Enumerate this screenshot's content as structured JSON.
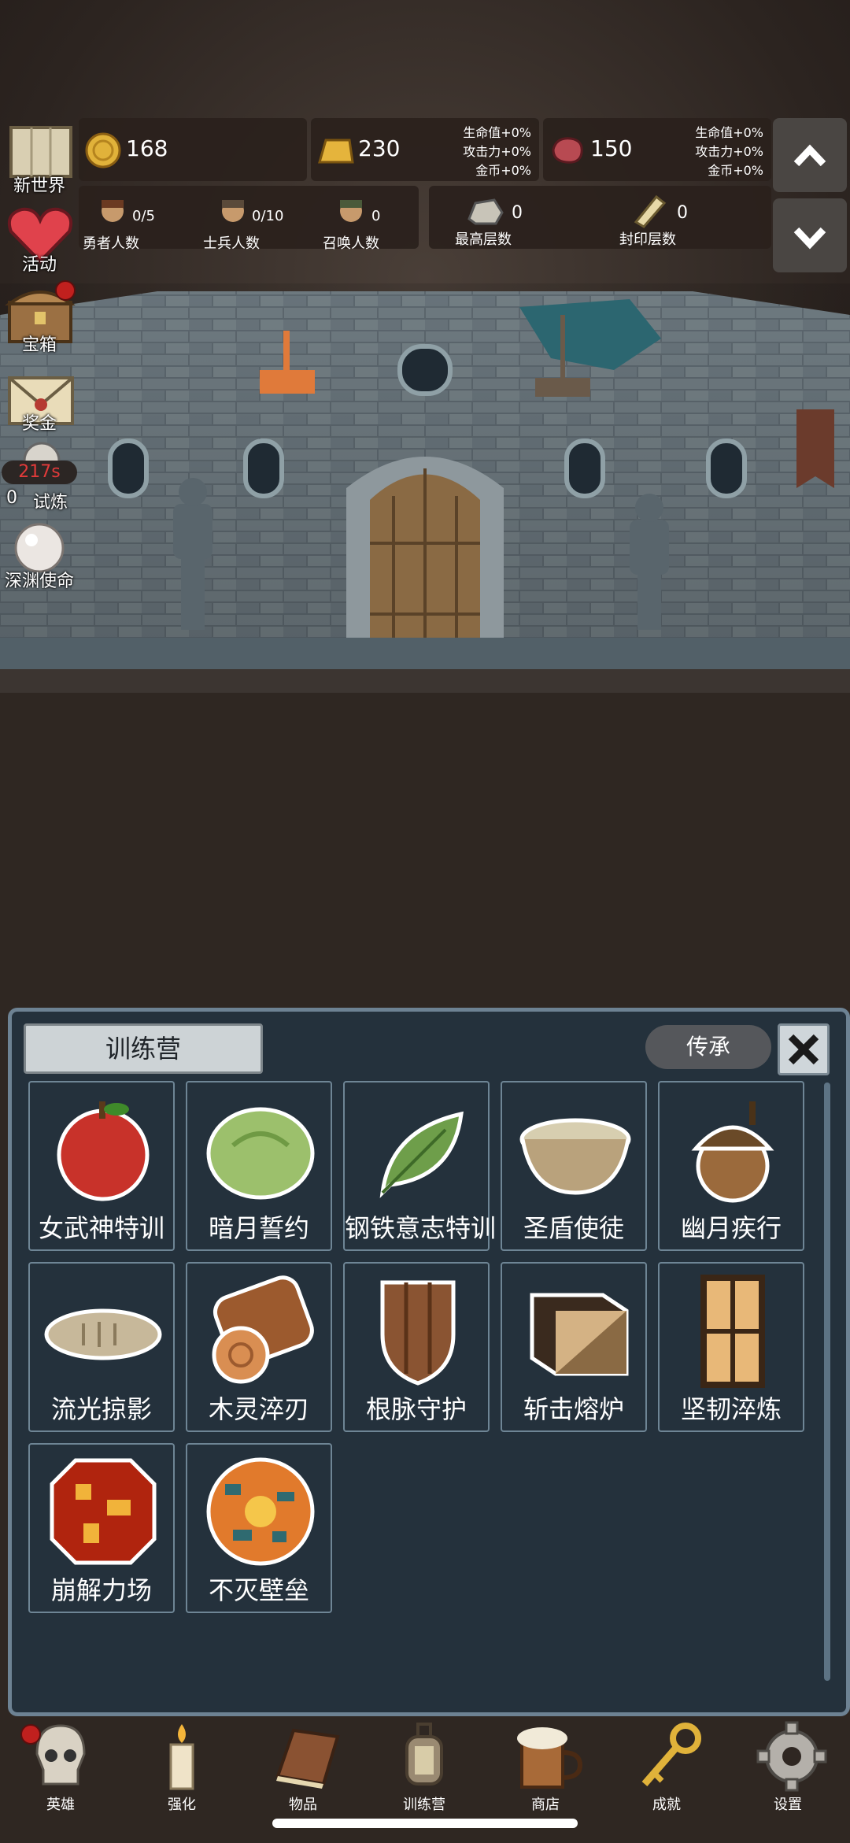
{
  "resources": {
    "gold": "168",
    "bar": "230",
    "bar_bonus": [
      "生命值+0%",
      "攻击力+0%",
      "金币+0%"
    ],
    "meat": "150",
    "meat_bonus": [
      "生命值+0%",
      "攻击力+0%",
      "金币+0%"
    ]
  },
  "counts": [
    {
      "value": "0/5",
      "label": "勇者人数"
    },
    {
      "value": "0/10",
      "label": "士兵人数"
    },
    {
      "value": "0",
      "label": "召唤人数"
    }
  ],
  "floors": [
    {
      "value": "0",
      "label": "最高层数"
    },
    {
      "value": "0",
      "label": "封印层数"
    }
  ],
  "side_menu": [
    {
      "label": "新世界",
      "icon": "map-icon"
    },
    {
      "label": "活动",
      "icon": "heart-icon"
    },
    {
      "label": "宝箱",
      "icon": "chest-icon"
    },
    {
      "label": "奖金",
      "icon": "envelope-icon"
    },
    {
      "label": "试炼",
      "icon": "trial-icon",
      "timer": "217s",
      "prefix": "0"
    },
    {
      "label": "深渊使命",
      "icon": "pearl-icon"
    }
  ],
  "panel": {
    "title": "训练营",
    "inherit": "传承",
    "items": [
      {
        "label": "女武神特训",
        "icon": "apple-icon"
      },
      {
        "label": "暗月誓约",
        "icon": "cabbage-icon"
      },
      {
        "label": "钢铁意志特训",
        "icon": "leaf-icon"
      },
      {
        "label": "圣盾使徒",
        "icon": "porridge-bowl-icon"
      },
      {
        "label": "幽月疾行",
        "icon": "acorn-icon"
      },
      {
        "label": "流光掠影",
        "icon": "fish-icon"
      },
      {
        "label": "木灵淬刃",
        "icon": "log-icon"
      },
      {
        "label": "根脉守护",
        "icon": "wooden-shield-icon"
      },
      {
        "label": "斩击熔炉",
        "icon": "cube-icon"
      },
      {
        "label": "坚韧淬炼",
        "icon": "plank-icon"
      },
      {
        "label": "崩解力场",
        "icon": "lava-orb-icon"
      },
      {
        "label": "不灭壁垒",
        "icon": "sun-orb-icon"
      }
    ]
  },
  "nav": [
    {
      "label": "英雄",
      "icon": "skull-icon"
    },
    {
      "label": "强化",
      "icon": "candle-icon"
    },
    {
      "label": "物品",
      "icon": "book-icon"
    },
    {
      "label": "训练营",
      "icon": "lantern-icon"
    },
    {
      "label": "商店",
      "icon": "beer-mug-icon"
    },
    {
      "label": "成就",
      "icon": "key-icon"
    },
    {
      "label": "设置",
      "icon": "gear-icon"
    }
  ]
}
